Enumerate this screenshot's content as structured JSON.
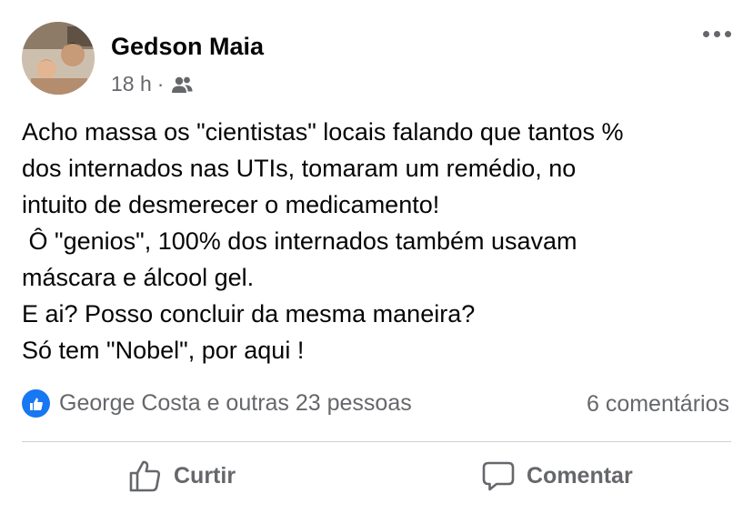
{
  "post": {
    "author": "Gedson Maia",
    "time": "18 h",
    "audience_icon": "friends-icon",
    "lines": [
      "Acho massa os \"cientistas\" locais falando que tantos %",
      "dos internados nas UTIs, tomaram um remédio, no",
      "intuito de desmerecer o medicamento!",
      " Ô \"genios\", 100% dos internados também usavam",
      "máscara e álcool gel.",
      "E ai? Posso concluir da mesma maneira?",
      "Só tem \"Nobel\", por aqui !"
    ]
  },
  "reactions": {
    "text": "George Costa e outras 23 pessoas",
    "icon": "like-reaction-icon",
    "comments": "6 comentários"
  },
  "actions": {
    "like": "Curtir",
    "comment": "Comentar"
  },
  "colors": {
    "accent": "#1877f2",
    "secondary_text": "#65676b",
    "divider": "#ced0d4"
  }
}
